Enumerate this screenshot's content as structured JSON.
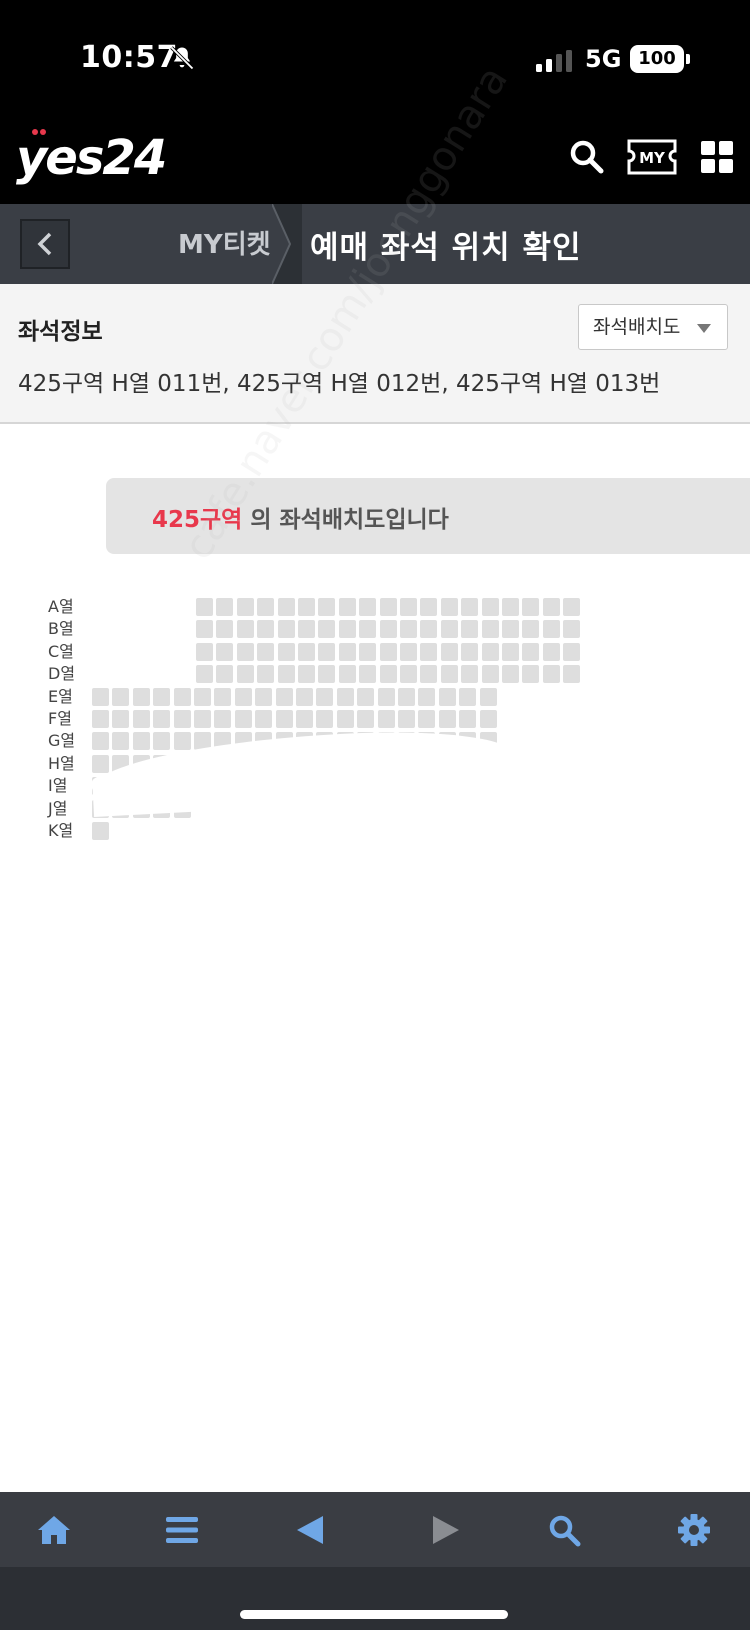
{
  "status": {
    "time": "10:57",
    "network": "5G",
    "battery": "100"
  },
  "header": {
    "logo": "yes24"
  },
  "subnav": {
    "crumb": "MY티켓",
    "title": "예매 좌석 위치 확인"
  },
  "seat_info": {
    "title": "좌석정보",
    "dropdown": "좌석배치도",
    "detail": "425구역 H열 011번, 425구역 H열 012번, 425구역 H열 013번"
  },
  "map": {
    "zone": "425구역",
    "banner_suffix": " 의 좌석배치도입니다",
    "rows": [
      "A열",
      "B열",
      "C열",
      "D열",
      "E열",
      "F열",
      "G열",
      "H열",
      "I열",
      "J열",
      "K열"
    ]
  },
  "watermark": "cafe.naver.com/joonggonara",
  "colors": {
    "accent": "#e8384c",
    "nav": "#3a3e45",
    "icon": "#6fa7e6"
  },
  "bottom_nav": [
    "home-icon",
    "menu-icon",
    "back-arrow-icon",
    "forward-arrow-icon",
    "search-icon",
    "settings-icon"
  ]
}
